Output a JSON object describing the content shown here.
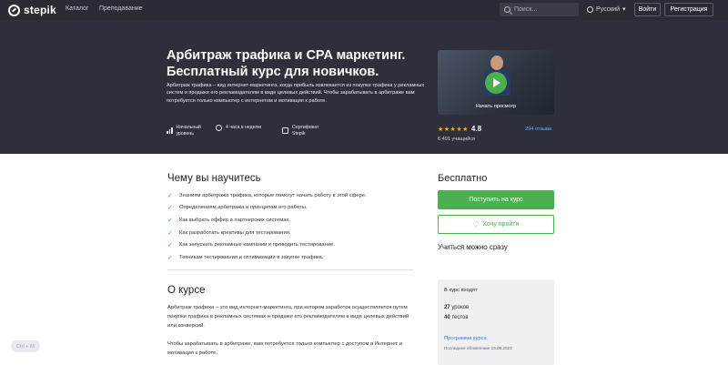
{
  "header": {
    "logo_text": "stepik",
    "nav": [
      "Каталог",
      "Преподавание"
    ],
    "search_placeholder": "Поиск...",
    "language": "Русский",
    "login_label": "Войти",
    "register_label": "Регистрация"
  },
  "course": {
    "title": "Арбитраж трафика и CPA маркетинг. Бесплатный курс для новичков.",
    "description": "Арбитраж трафика – вид интернет-маркетинга, когда прибыль извлекается из покупки трафика у рекламных систем и продажи его рекламодателям в виде целевых действий. Чтобы зарабатывать в арбитраже вам потребуется только компьютер с интернетом и мотивация к работе.",
    "meta": {
      "level_line1": "Начальный",
      "level_line2": "уровень",
      "duration": "4 часа в неделю",
      "cert_line1": "Сертификат",
      "cert_line2": "Stepik"
    },
    "video_label": "Начать просмотр",
    "stars": "★★★★★",
    "rating": "4.8",
    "reviews": "294 отзыва",
    "students": "6 491 учащийся"
  },
  "learn": {
    "title": "Чему вы научитесь",
    "items": [
      "Знаниям арбитража трафика, которые помогут начать работу в этой сфере.",
      "Определениям арбитража и принципам его работы.",
      "Как выбрать оффер в партнерских системах.",
      "Как разработать креативы для тестирования.",
      "Как запускать рекламные кампании и проводить тестирование.",
      "Техникам тестирования и оптимизации в закупке трафика."
    ]
  },
  "about": {
    "title": "О курсе",
    "p1": "Арбитраж трафика – это вид интернет-маркетинга, при котором заработок осуществляется путем покупки трафика в рекламных системах и продажи его рекламодателям в виде целевых действий или конверсий.",
    "p2": "Чтобы зарабатывать в арбитраже, вам потребуется только компьютер с доступом в Интернет и мотивация к работе."
  },
  "sidebar": {
    "price": "Бесплатно",
    "enroll_label": "Поступить на курс",
    "wish_label": "Хочу пройти",
    "learn_now": "Учиться можно сразу",
    "includes_title": "В курс входят",
    "lessons_count": "27",
    "lessons_word": "уроков",
    "tests_count": "40",
    "tests_word": "тестов",
    "program_link": "Программа курса",
    "updated": "Последнее обновление 16.09.2023"
  },
  "shortcut_hint": "Ctrl + M",
  "colors": {
    "topbar": "#2a2b33",
    "hero": "#2e2f3a",
    "accent_green": "#4caf50",
    "link_blue": "#3d7bd9",
    "star": "#f5b301"
  }
}
